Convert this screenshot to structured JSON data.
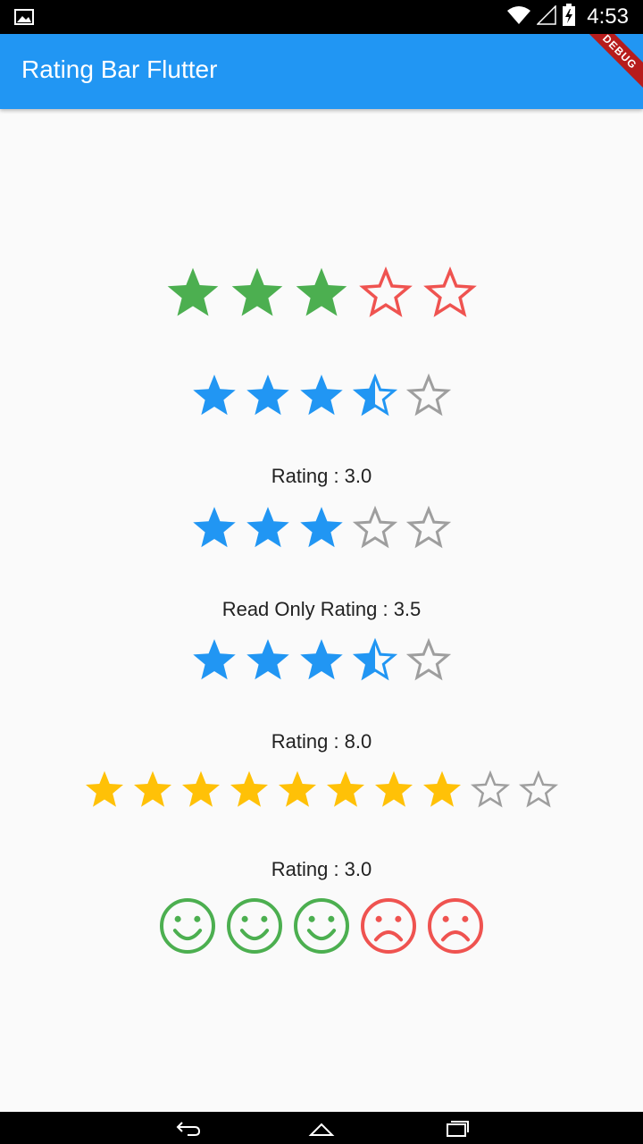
{
  "status_bar": {
    "time": "4:53",
    "icons": [
      "image-icon",
      "wifi-icon",
      "signal-icon",
      "battery-charging-icon"
    ]
  },
  "app_bar": {
    "title": "Rating Bar Flutter",
    "debug_banner": "DEBUG",
    "color": "#2196f3"
  },
  "ratings": [
    {
      "id": "rating-1",
      "type": "star",
      "count": 5,
      "value": 3,
      "filled_color": "#4caf50",
      "empty_color": "#ef5350",
      "interactive": true
    },
    {
      "id": "rating-2",
      "type": "star",
      "count": 5,
      "value": 3.5,
      "filled_color": "#2196f3",
      "empty_color": "#9e9e9e",
      "interactive": true
    },
    {
      "id": "rating-3",
      "label": "Rating : 3.0",
      "type": "star",
      "count": 5,
      "value": 3,
      "filled_color": "#2196f3",
      "empty_color": "#9e9e9e",
      "interactive": true
    },
    {
      "id": "rating-4",
      "label": "Read Only Rating : 3.5",
      "type": "star",
      "count": 5,
      "value": 3.5,
      "filled_color": "#2196f3",
      "empty_color": "#9e9e9e",
      "interactive": false
    },
    {
      "id": "rating-5",
      "label": "Rating : 8.0",
      "type": "star",
      "count": 10,
      "value": 8,
      "filled_color": "#ffc107",
      "empty_color": "#9e9e9e",
      "interactive": true
    },
    {
      "id": "rating-6",
      "label": "Rating : 3.0",
      "type": "smiley",
      "count": 5,
      "value": 3,
      "filled_color": "#4caf50",
      "empty_color": "#ef5350",
      "interactive": true
    }
  ],
  "nav_bar": {
    "buttons": [
      "back-icon",
      "home-icon",
      "recents-icon"
    ]
  }
}
